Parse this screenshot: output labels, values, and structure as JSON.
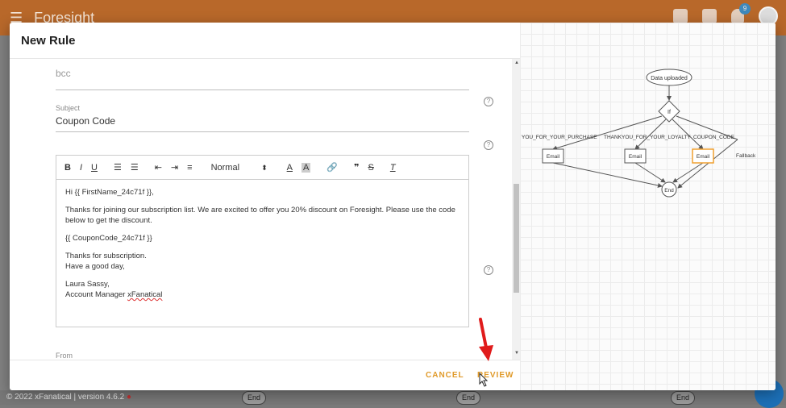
{
  "app": {
    "title": "Foresight",
    "notification_count": "9",
    "footer_text": "© 2022 xFanatical | version 4.6.2",
    "footer_dot": "●",
    "background_end_label": "End"
  },
  "modal": {
    "title": "New Rule",
    "bcc_value": "bcc",
    "subject_label": "Subject",
    "subject_value": "Coupon Code",
    "from_label": "From",
    "help_glyph": "?",
    "editor": {
      "toolbar": {
        "bold": "B",
        "italic": "I",
        "underline": "U",
        "ordered_list": "☰",
        "bullet_list": "☰",
        "outdent": "⇤",
        "indent": "⇥",
        "align": "≡",
        "format_select": "Normal",
        "select_arrow": "⬍",
        "font_color": "A",
        "highlight": "A",
        "link": "🔗",
        "quote": "❞",
        "strike": "S",
        "clear": "T"
      },
      "content": {
        "greeting": "Hi {{ FirstName_24c71f }},",
        "body": "Thanks for joining our subscription list. We are excited to offer you 20% discount on Foresight. Please use the code below to get the discount.",
        "coupon": "{{ CouponCode_24c71f }}",
        "thanks": "Thanks for subscription.",
        "day": "Have a good day,",
        "name": "Laura Sassy,",
        "signature_prefix": "Account Manager ",
        "signature_brand": "xFanatical"
      }
    },
    "buttons": {
      "cancel": "CANCEL",
      "review": "REVIEW"
    }
  },
  "flow": {
    "start": "Data uploaded",
    "decision": "If",
    "branches": [
      {
        "label": "YOU_FOR_YOUR_PURCHASE",
        "node": "Email"
      },
      {
        "label": "THANKYOU_FOR_YOUR_LOYALTY",
        "node": "Email"
      },
      {
        "label": "COUPON_CODE",
        "node": "Email",
        "highlight": "#f0a030"
      },
      {
        "label": "Fallback"
      }
    ],
    "end": "End"
  },
  "colors": {
    "accent": "#e09a2a",
    "app_bar": "#b8682a",
    "annotation_arrow": "#e01b1b"
  }
}
